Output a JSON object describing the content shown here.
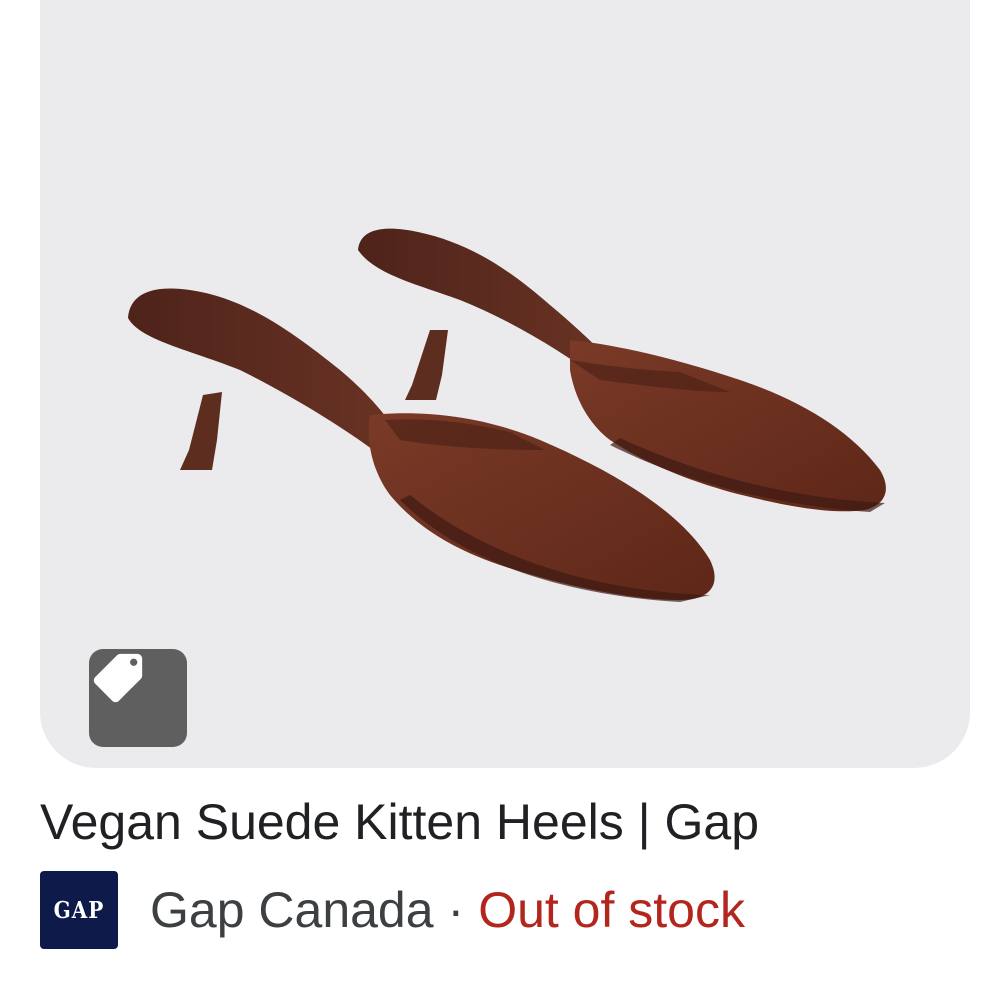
{
  "product": {
    "title": "Vegan Suede Kitten Heels | Gap",
    "image_alt_icon": "shoe-image",
    "tag_icon": "price-tag-icon"
  },
  "merchant": {
    "logo_text": "GAP",
    "name": "Gap Canada",
    "separator": "·",
    "availability": "Out of stock"
  },
  "colors": {
    "image_background": "#ebebed",
    "badge_background": "#5f5f5f",
    "title_text": "#202124",
    "merchant_text": "#3c4043",
    "availability_text": "#b3261e",
    "logo_background": "#0d1a4a",
    "shoe_suede": "#6b2e1e"
  }
}
